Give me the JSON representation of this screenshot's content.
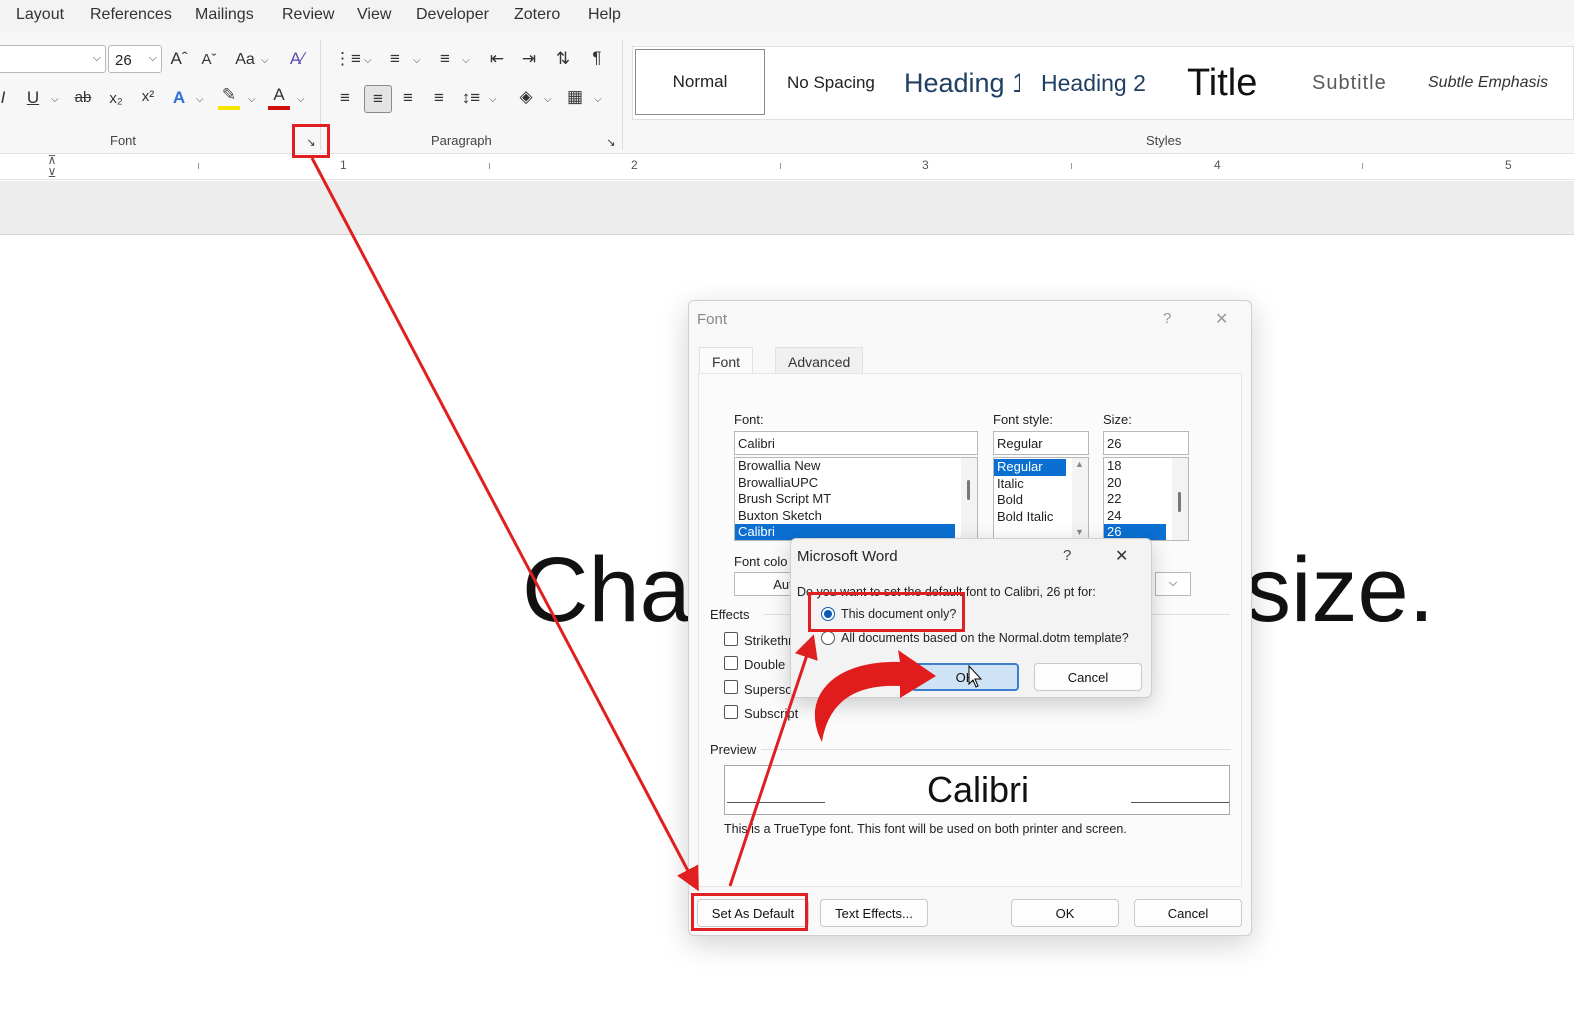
{
  "menubar": {
    "items": [
      "Layout",
      "References",
      "Mailings",
      "Review",
      "View",
      "Developer",
      "Zotero",
      "Help"
    ]
  },
  "ribbon": {
    "font_size_value": "26",
    "change_case_label": "Aa",
    "group_font_label": "Font",
    "group_paragraph_label": "Paragraph",
    "group_styles_label": "Styles",
    "styles": [
      "Normal",
      "No Spacing",
      "Heading 1",
      "Heading 2",
      "Title",
      "Subtitle",
      "Subtle Emphasis"
    ]
  },
  "ruler": {
    "numbers": [
      "1",
      "2",
      "3",
      "4",
      "5"
    ]
  },
  "document": {
    "text_left": "Cha",
    "text_right": "size."
  },
  "font_dialog": {
    "title": "Font",
    "help": "?",
    "close": "✕",
    "tabs": [
      "Font",
      "Advanced"
    ],
    "font_label": "Font:",
    "font_value": "Calibri",
    "font_list": [
      "Browallia New",
      "BrowalliaUPC",
      "Brush Script MT",
      "Buxton Sketch",
      "Calibri"
    ],
    "style_label": "Font style:",
    "style_value": "Regular",
    "style_list": [
      "Regular",
      "Italic",
      "Bold",
      "Bold Italic"
    ],
    "size_label": "Size:",
    "size_value": "26",
    "size_list": [
      "18",
      "20",
      "22",
      "24",
      "26"
    ],
    "font_color_label": "Font colo",
    "font_color_value": "Auto",
    "effects_label": "Effects",
    "effects": [
      "Strikethr",
      "Double",
      "Supersc",
      "Subscript"
    ],
    "preview_label": "Preview",
    "preview_text": "Calibri",
    "preview_note": "This is a TrueType font. This font will be used on both printer and screen.",
    "buttons": {
      "set_default": "Set As Default",
      "text_effects": "Text Effects...",
      "ok": "OK",
      "cancel": "Cancel"
    }
  },
  "confirm_dialog": {
    "title": "Microsoft Word",
    "help": "?",
    "close": "✕",
    "question": "Do you want to set the default font to Calibri, 26 pt for:",
    "option_1": "This document only?",
    "option_2": "All documents based on the Normal.dotm template?",
    "selected_option": "option_1",
    "ok": "OK",
    "cancel": "Cancel"
  },
  "colors": {
    "annotation_red": "#e02020",
    "selection_blue": "#0a6fd1",
    "heading_blue": "#1f3f63"
  }
}
